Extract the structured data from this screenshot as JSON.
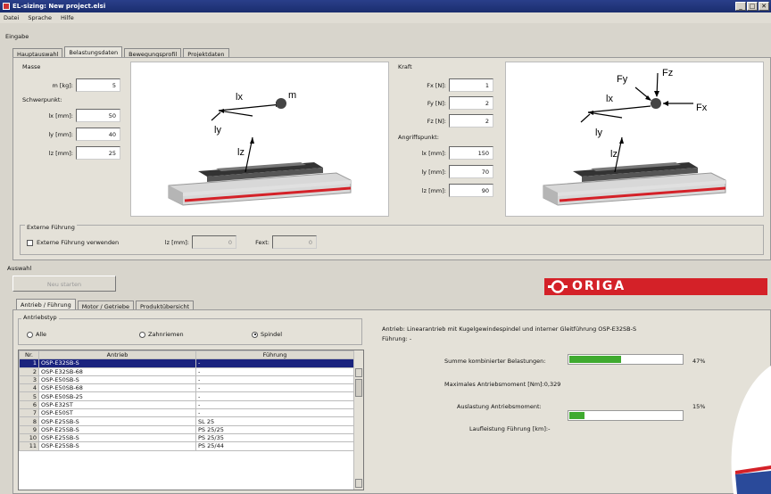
{
  "window": {
    "title": "EL-sizing: New project.elsi",
    "btns": [
      "_",
      "□",
      "✕"
    ]
  },
  "menu": [
    "Datei",
    "Sprache",
    "Hilfe"
  ],
  "eingabe": {
    "label": "Eingabe",
    "tabs": [
      "Hauptauswahl",
      "Belastungsdaten",
      "Bewegungsprofil",
      "Projektdaten"
    ],
    "active_tab": 1,
    "masse": {
      "label": "Masse",
      "m_label": "m [kg]:",
      "m_value": "5",
      "schwerpunkt_label": "Schwerpunkt:",
      "fields": [
        {
          "label": "lx [mm]:",
          "value": "50"
        },
        {
          "label": "ly [mm]:",
          "value": "40"
        },
        {
          "label": "lz [mm]:",
          "value": "25"
        }
      ]
    },
    "kraft": {
      "label": "Kraft",
      "fields": [
        {
          "label": "Fx [N]:",
          "value": "1"
        },
        {
          "label": "Fy [N]:",
          "value": "2"
        },
        {
          "label": "Fz [N]:",
          "value": "2"
        }
      ],
      "angriff_label": "Angriffspunkt:",
      "angriff_fields": [
        {
          "label": "lx [mm]:",
          "value": "150"
        },
        {
          "label": "ly [mm]:",
          "value": "70"
        },
        {
          "label": "lz [mm]:",
          "value": "90"
        }
      ]
    },
    "diagram_left": {
      "m": "m",
      "lx": "lx",
      "ly": "ly",
      "lz": "lz"
    },
    "diagram_right": {
      "fy": "Fy",
      "fz": "Fz",
      "fx": "Fx",
      "lx": "lx",
      "ly": "ly",
      "lz": "lz"
    },
    "ext": {
      "label": "Externe Führung",
      "checkbox_label": "Externe Führung verwenden",
      "l_label": "lz [mm]:",
      "l_value": "0",
      "f_label": "Fext:",
      "f_value": "0"
    }
  },
  "auswahl": {
    "label": "Auswahl",
    "button": "Neu starten",
    "logo": "ORIGA",
    "tabs": [
      "Antrieb / Führung",
      "Motor / Getriebe",
      "Produktübersicht"
    ],
    "antriebstyp": {
      "label": "Antriebstyp",
      "options": [
        "Alle",
        "Zahnriemen",
        "Spindel"
      ],
      "selected": 2
    },
    "table": {
      "headers": [
        "Nr.",
        "Antrieb",
        "Führung"
      ],
      "rows": [
        [
          "1",
          "OSP-E32SB-S",
          "-"
        ],
        [
          "2",
          "OSP-E32SB-68",
          "-"
        ],
        [
          "3",
          "OSP-E50SB-S",
          "-"
        ],
        [
          "4",
          "OSP-E50SB-68",
          "-"
        ],
        [
          "5",
          "OSP-E50SB-25",
          "-"
        ],
        [
          "6",
          "OSP-E32ST",
          "-"
        ],
        [
          "7",
          "OSP-E50ST",
          "-"
        ],
        [
          "8",
          "OSP-E25SB-S",
          "SL 25"
        ],
        [
          "9",
          "OSP-E25SB-S",
          "PS 25/25"
        ],
        [
          "10",
          "OSP-E25SB-S",
          "PS 25/35"
        ],
        [
          "11",
          "OSP-E25SB-S",
          "PS 25/44"
        ]
      ],
      "selected_row": 0
    },
    "details": {
      "antrieb_text": "Antrieb: Linearantrieb mit Kugelgewindespindel und interner Gleitführung OSP-E32SB-S",
      "fuehrung_text": "Führung: -",
      "summe_label": "Summe kombinierter Belastungen:",
      "summe_value": "47%",
      "summe_fill": 0.47,
      "max_label": "Maximales Antriebsmoment [Nm]:0,329",
      "auslastung_label": "Auslastung Antriebsmoment:",
      "auslastung_value": "15%",
      "auslastung_fill": 0.15,
      "lauf_label": "Laufleistung Führung [km]:-"
    }
  },
  "colors": {
    "titlebar": "#1a2d6e",
    "selection": "#1a237e",
    "origa_red": "#d42128",
    "bar_green": "#3faa2f"
  }
}
